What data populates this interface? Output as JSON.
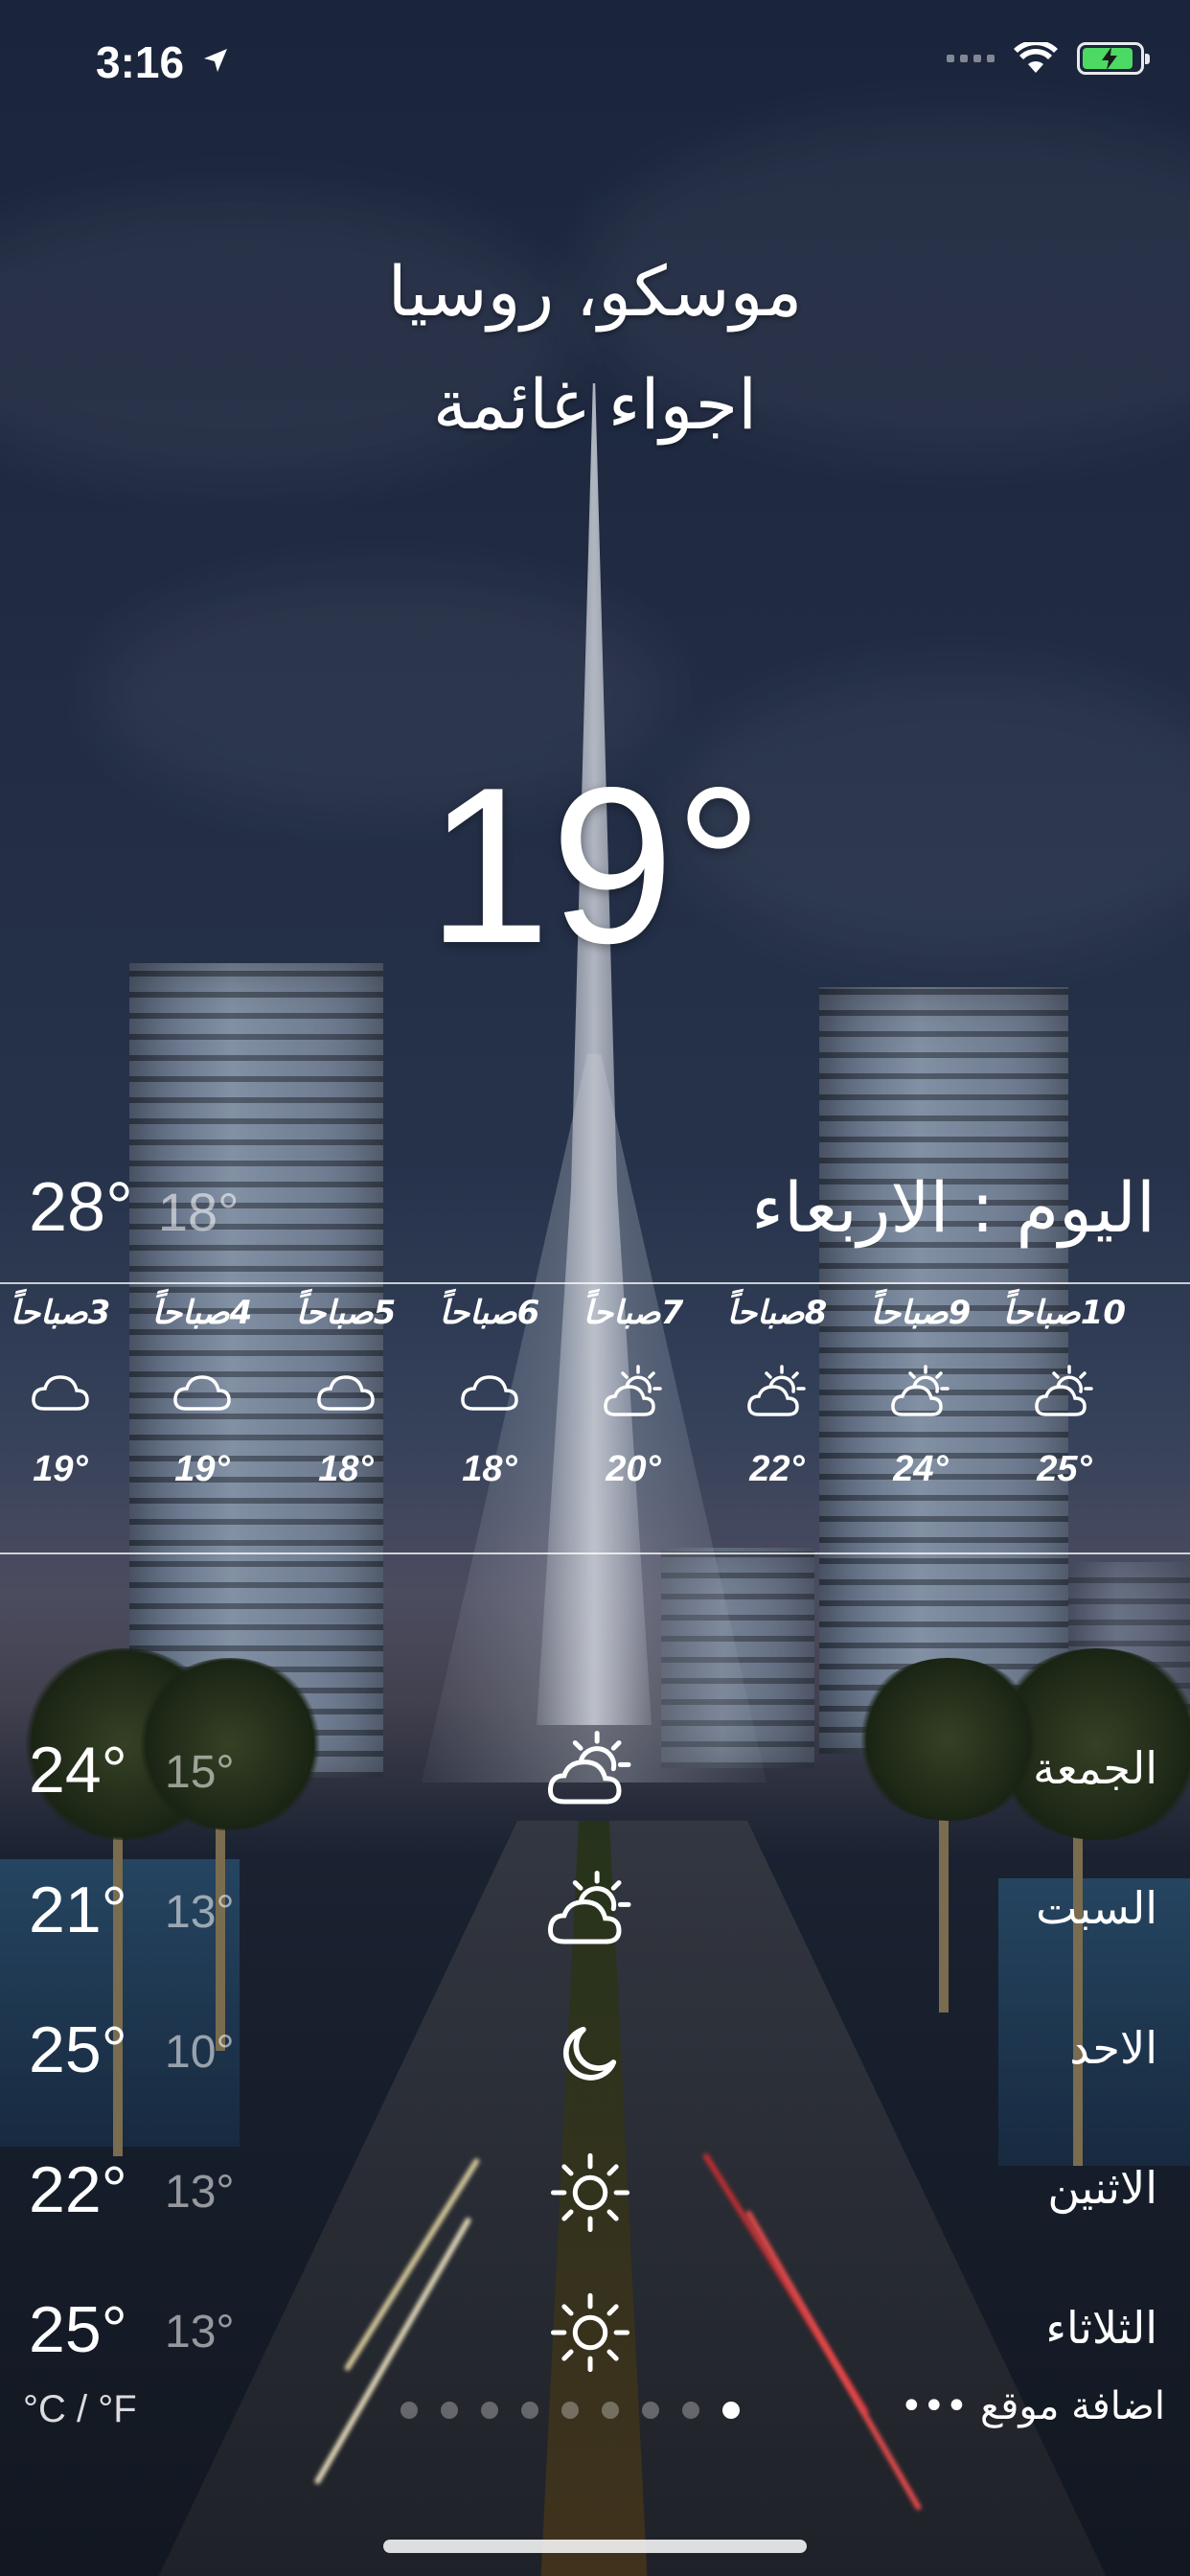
{
  "status_bar": {
    "time": "3:16",
    "battery_color": "#4cd964"
  },
  "header": {
    "city": "موسكو، روسيا",
    "condition": "اجواء غائمة",
    "temperature": "19°"
  },
  "today": {
    "label": "اليوم : الاربعاء",
    "high": "28°",
    "low": "18°"
  },
  "hourly": [
    {
      "label": "3صباحاً",
      "temp": "19°",
      "icon": "cloud-icon"
    },
    {
      "label": "4صباحاً",
      "temp": "19°",
      "icon": "cloud-icon"
    },
    {
      "label": "5صباحاً",
      "temp": "18°",
      "icon": "cloud-icon"
    },
    {
      "label": "6صباحاً",
      "temp": "18°",
      "icon": "cloud-icon"
    },
    {
      "label": "7صباحاً",
      "temp": "20°",
      "icon": "partly-cloudy-icon"
    },
    {
      "label": "8صباحاً",
      "temp": "22°",
      "icon": "partly-cloudy-icon"
    },
    {
      "label": "9صباحاً",
      "temp": "24°",
      "icon": "partly-cloudy-icon"
    },
    {
      "label": "10صباحاً",
      "temp": "25°",
      "icon": "partly-cloudy-icon"
    }
  ],
  "daily": [
    {
      "day": "الجمعة",
      "high": "24°",
      "low": "15°",
      "icon": "partly-cloudy-icon"
    },
    {
      "day": "السبت",
      "high": "21°",
      "low": "13°",
      "icon": "partly-cloudy-icon"
    },
    {
      "day": "الاحد",
      "high": "25°",
      "low": "10°",
      "icon": "moon-icon"
    },
    {
      "day": "الاثنين",
      "high": "22°",
      "low": "13°",
      "icon": "sun-icon"
    },
    {
      "day": "الثلاثاء",
      "high": "25°",
      "low": "13°",
      "icon": "sun-icon"
    }
  ],
  "bottom_bar": {
    "units": "°C / °F",
    "add_location": "اضافة موقع",
    "page_count": 9,
    "active_page": 9
  }
}
